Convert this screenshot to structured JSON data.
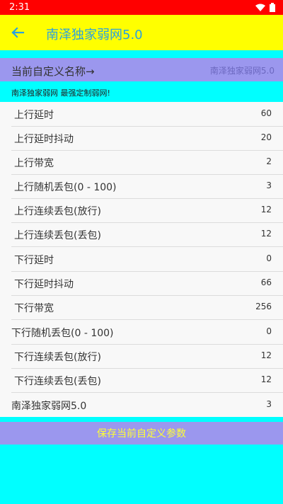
{
  "status_bar": {
    "time": "2:31",
    "icons": [
      "wifi-icon",
      "battery-icon"
    ]
  },
  "app_bar": {
    "title": "南泽独家弱网5.0",
    "back_icon": "arrow-left-icon"
  },
  "name_row": {
    "label": "当前自定义名称→",
    "hint": "南泽独家弱网5.0"
  },
  "subtitle": "南泽独家弱网  最强定制弱网!",
  "settings": [
    {
      "label": "上行延时",
      "value": "60"
    },
    {
      "label": "上行延时抖动",
      "value": "20"
    },
    {
      "label": "上行带宽",
      "value": "2"
    },
    {
      "label": "上行随机丢包(0 - 100)",
      "value": "3"
    },
    {
      "label": "上行连续丢包(放行)",
      "value": "12"
    },
    {
      "label": "上行连续丢包(丢包)",
      "value": "12"
    },
    {
      "label": "下行延时",
      "value": "0"
    },
    {
      "label": "下行延时抖动",
      "value": "66"
    },
    {
      "label": "下行带宽",
      "value": "256"
    },
    {
      "label": "下行随机丢包(0 - 100)",
      "value": "0"
    },
    {
      "label": "下行连续丢包(放行)",
      "value": "12"
    },
    {
      "label": "下行连续丢包(丢包)",
      "value": "12"
    },
    {
      "label": "南泽独家弱网5.0",
      "value": "3"
    }
  ],
  "save_button": "保存当前自定义参数",
  "colors": {
    "status_bar": "#ff0000",
    "app_bar": "#ffff00",
    "title": "#2aa1e0",
    "background": "#00ffff",
    "accent": "#9b97ee",
    "save_text": "#ffff33"
  }
}
